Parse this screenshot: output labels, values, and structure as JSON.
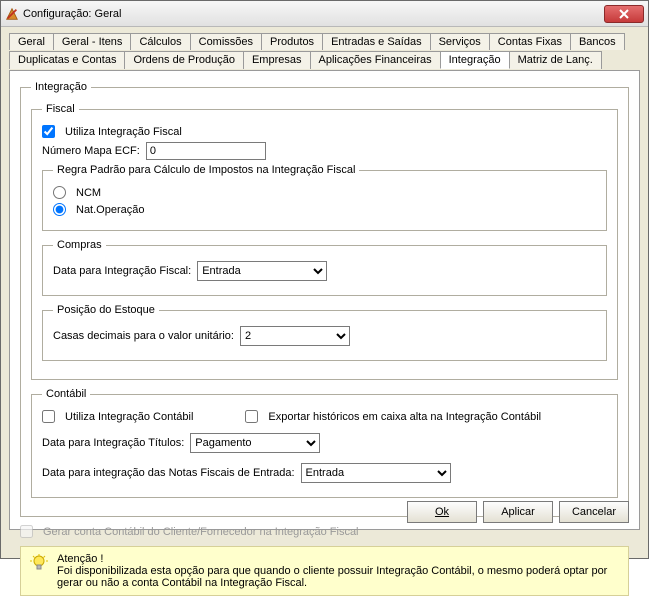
{
  "window": {
    "title": "Configuração: Geral"
  },
  "tabsRow1": [
    {
      "label": "Geral"
    },
    {
      "label": "Geral - Itens"
    },
    {
      "label": "Cálculos"
    },
    {
      "label": "Comissões"
    },
    {
      "label": "Produtos"
    },
    {
      "label": "Entradas e Saídas"
    },
    {
      "label": "Serviços"
    },
    {
      "label": "Contas Fixas"
    },
    {
      "label": "Bancos"
    }
  ],
  "tabsRow2": [
    {
      "label": "Duplicatas e Contas"
    },
    {
      "label": "Ordens de Produção"
    },
    {
      "label": "Empresas"
    },
    {
      "label": "Aplicações Financeiras"
    },
    {
      "label": "Integração",
      "active": true
    },
    {
      "label": "Matriz de Lanç."
    }
  ],
  "groups": {
    "integracao": "Integração",
    "fiscal": "Fiscal",
    "regra": "Regra Padrão para Cálculo de Impostos na Integração Fiscal",
    "compras": "Compras",
    "estoque": "Posição do Estoque",
    "contabil": "Contábil"
  },
  "fiscal": {
    "utilizaLabel": "Utiliza Integração Fiscal",
    "utilizaChecked": true,
    "numeroMapaLabel": "Número Mapa ECF:",
    "numeroMapaValue": "0",
    "ncmLabel": "NCM",
    "natOperacaoLabel": "Nat.Operação",
    "radioSelected": "natop",
    "comprasDataLabel": "Data para Integração Fiscal:",
    "comprasDataValue": "Entrada",
    "casasLabel": "Casas decimais para o valor unitário:",
    "casasValue": "2"
  },
  "contabil": {
    "utilizaLabel": "Utiliza Integração Contábil",
    "utilizaChecked": false,
    "exportarLabel": "Exportar históricos em caixa alta na Integração Contábil",
    "exportarChecked": false,
    "dataTitulosLabel": "Data para Integração Títulos:",
    "dataTitulosValue": "Pagamento",
    "dataNFLabel": "Data para integração das Notas Fiscais de Entrada:",
    "dataNFValue": "Entrada"
  },
  "gerarConta": {
    "label": "Gerar conta Contábil do Cliente/Fornecedor na Integração Fiscal",
    "checked": false,
    "enabled": false
  },
  "note": {
    "title": "Atenção !",
    "body": "Foi disponibilizada esta opção para que quando o cliente possuir Integração Contábil, o mesmo poderá optar por gerar ou não a conta Contábil na Integração Fiscal."
  },
  "buttons": {
    "ok": "Ok",
    "aplicar": "Aplicar",
    "cancelar": "Cancelar"
  }
}
